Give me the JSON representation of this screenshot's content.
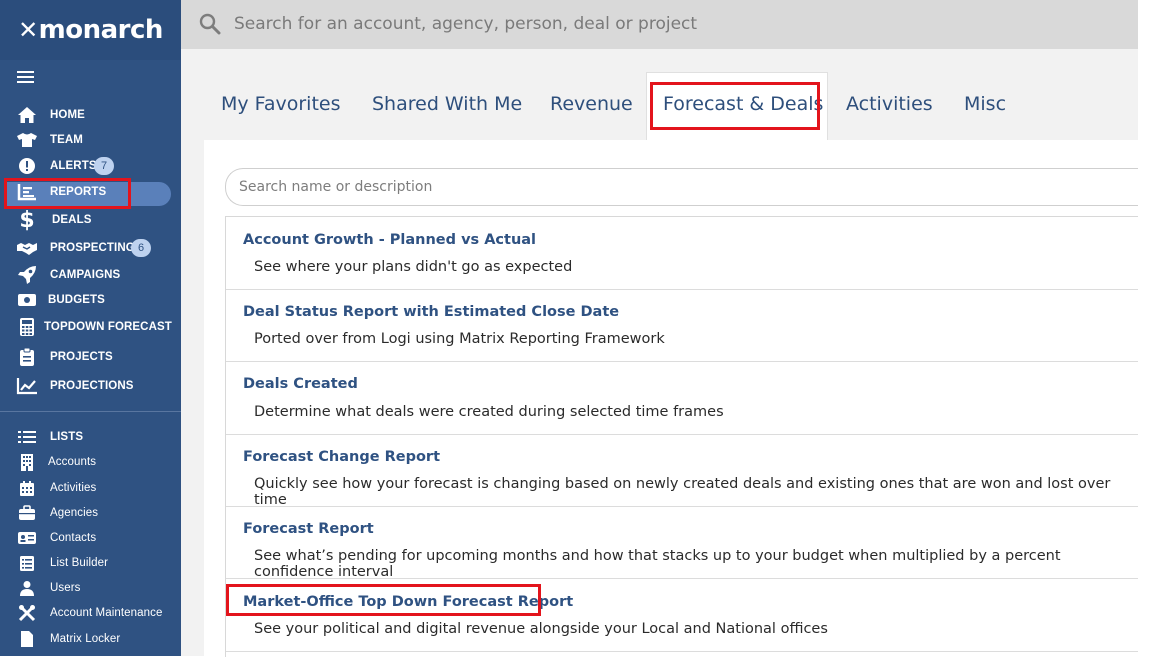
{
  "app": {
    "logo_text": "monarch"
  },
  "sidebar": {
    "items": [
      {
        "label": "HOME",
        "icon": "home-icon"
      },
      {
        "label": "TEAM",
        "icon": "shirt-icon"
      },
      {
        "label": "ALERTS",
        "icon": "alert-icon",
        "badge": "7"
      },
      {
        "label": "REPORTS",
        "icon": "report-icon",
        "active": true
      },
      {
        "label": "DEALS",
        "icon": "dollar-icon"
      },
      {
        "label": "PROSPECTING",
        "icon": "handshake-icon",
        "badge": "6"
      },
      {
        "label": "CAMPAIGNS",
        "icon": "rocket-icon"
      },
      {
        "label": "BUDGETS",
        "icon": "money-icon"
      },
      {
        "label": "TOPDOWN FORECAST",
        "icon": "calculator-icon"
      },
      {
        "label": "PROJECTS",
        "icon": "clipboard-icon"
      },
      {
        "label": "PROJECTIONS",
        "icon": "chart-line-icon"
      }
    ],
    "lists_header": "LISTS",
    "list_items": [
      {
        "label": "Accounts",
        "icon": "building-icon"
      },
      {
        "label": "Activities",
        "icon": "calendar-icon"
      },
      {
        "label": "Agencies",
        "icon": "briefcase-icon"
      },
      {
        "label": "Contacts",
        "icon": "contact-card-icon"
      },
      {
        "label": "List Builder",
        "icon": "list-builder-icon"
      },
      {
        "label": "Users",
        "icon": "user-icon"
      },
      {
        "label": "Account Maintenance",
        "icon": "tools-icon"
      },
      {
        "label": "Matrix Locker",
        "icon": "document-icon"
      }
    ]
  },
  "search": {
    "placeholder": "Search for an account, agency, person, deal or project"
  },
  "tabs": [
    {
      "label": "My Favorites"
    },
    {
      "label": "Shared With Me"
    },
    {
      "label": "Revenue"
    },
    {
      "label": "Forecast & Deals",
      "active": true
    },
    {
      "label": "Activities"
    },
    {
      "label": "Misc"
    }
  ],
  "report_filter": {
    "placeholder": "Search name or description"
  },
  "reports": [
    {
      "title": "Account Growth - Planned vs Actual",
      "description": "See where your plans didn't go as expected"
    },
    {
      "title": "Deal Status Report with Estimated Close Date",
      "description": "Ported over from Logi using Matrix Reporting Framework"
    },
    {
      "title": "Deals Created",
      "description": "Determine what deals were created during selected time frames"
    },
    {
      "title": "Forecast Change Report",
      "description": "Quickly see how your forecast is changing based on newly created deals and existing ones that are won and lost over time"
    },
    {
      "title": "Forecast Report",
      "description": "See what’s pending for upcoming months and how that stacks up to your budget when multiplied by a percent confidence interval"
    },
    {
      "title": "Market-Office Top Down Forecast Report",
      "description": "See your political and digital revenue alongside your Local and National offices"
    }
  ],
  "colors": {
    "sidebar": "#2f5282",
    "accent": "#2f5282",
    "highlight": "#e3141c"
  }
}
